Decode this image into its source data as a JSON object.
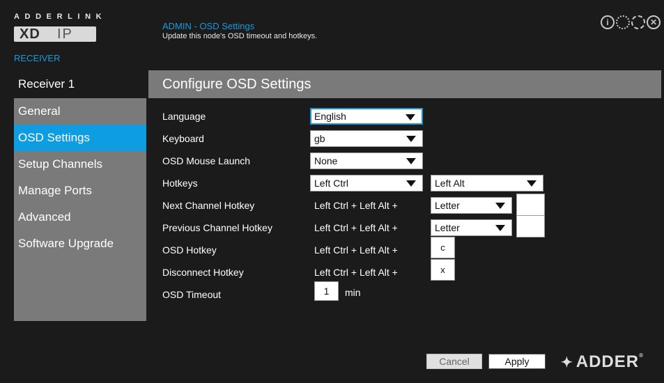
{
  "brand": {
    "top": "ADDERLINK",
    "product_left": "XD",
    "product_right": "IP",
    "receiver": "RECEIVER",
    "corporate": "ADDER",
    "registered": "®"
  },
  "header": {
    "title": "ADMIN - OSD Settings",
    "subtitle": "Update this node's OSD timeout and hotkeys.",
    "icons": [
      "info-icon",
      "gear-icon",
      "refresh-icon",
      "close-icon"
    ],
    "info_glyph": "i",
    "close_glyph": "✕"
  },
  "sidebar": {
    "header": "Receiver 1",
    "items": [
      {
        "label": "General"
      },
      {
        "label": "OSD Settings",
        "active": true
      },
      {
        "label": "Setup Channels"
      },
      {
        "label": "Manage Ports"
      },
      {
        "label": "Advanced"
      },
      {
        "label": "Software Upgrade"
      }
    ]
  },
  "main": {
    "title": "Configure OSD Settings",
    "language": {
      "label": "Language",
      "value": "English"
    },
    "keyboard": {
      "label": "Keyboard",
      "value": "gb"
    },
    "mouse_launch": {
      "label": "OSD Mouse Launch",
      "value": "None"
    },
    "hotkeys": {
      "label": "Hotkeys",
      "value1": "Left Ctrl",
      "value2": "Left Alt"
    },
    "next_channel": {
      "label": "Next Channel Hotkey",
      "prefix": "Left Ctrl + Left Alt +",
      "mode": "Letter",
      "key": ""
    },
    "prev_channel": {
      "label": "Previous Channel Hotkey",
      "prefix": "Left Ctrl + Left Alt +",
      "mode": "Letter",
      "key": ""
    },
    "osd_hotkey": {
      "label": "OSD Hotkey",
      "prefix": "Left Ctrl + Left Alt +",
      "key": "c"
    },
    "disconnect": {
      "label": "Disconnect Hotkey",
      "prefix": "Left Ctrl + Left Alt +",
      "key": "x"
    },
    "timeout": {
      "label": "OSD Timeout",
      "value": "1",
      "unit": "min"
    }
  },
  "buttons": {
    "cancel": "Cancel",
    "apply": "Apply"
  },
  "colors": {
    "accent": "#0e9de0",
    "panel": "#7a7a7a",
    "background": "#1b1b1b"
  }
}
